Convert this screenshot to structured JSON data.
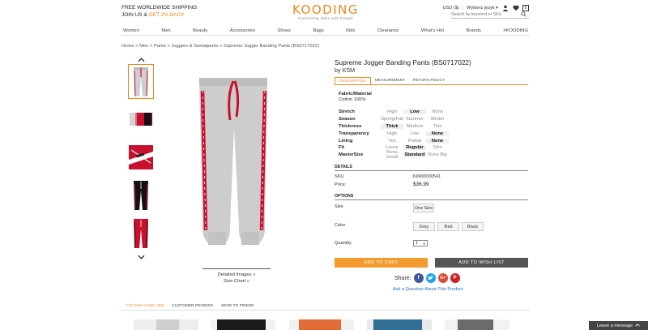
{
  "header": {
    "shipping_line1": "FREE WORLDWIDE SHIPPING",
    "join_prefix": "JOIN US & ",
    "join_accent": "GET 2% BACK",
    "logo_text": "KOODING",
    "logo_tagline": "Connecting Style with People",
    "currency": "USD ($)",
    "language": "Wybierz język",
    "cart_count": "0",
    "search_placeholder": "Search by keyword or SKU",
    "accent_color": "#e58a1f"
  },
  "nav": {
    "items": [
      "Women",
      "Men",
      "Beauty",
      "Accessories",
      "Shoes",
      "Bags",
      "Kids",
      "Clearance",
      "What's Hot",
      "Brands",
      "#KOODING"
    ]
  },
  "breadcrumb": "Home > Men > Pants > Joggers & Sweatpants > Supreme Jogger Banding Pants (BS0717022)",
  "gallery": {
    "detailed_images": "Detailed Images »",
    "size_chart": "Size Chart »"
  },
  "product": {
    "title": "Supreme Jogger Banding Pants (BS0717022)",
    "byline": "by KSM",
    "tabs": [
      "DESCRIPTION",
      "MEASUREMENT",
      "RETURN POLICY"
    ],
    "fabric_label": "Fabric/Material",
    "fabric_value": "Cotton 100%",
    "attributes": [
      {
        "name": "Stretch",
        "options": [
          "High",
          "Low",
          "None"
        ],
        "selected": 1
      },
      {
        "name": "Season",
        "options": [
          "Spring/Fall",
          "Summer",
          "Winter"
        ],
        "selected": -1
      },
      {
        "name": "Thickness",
        "options": [
          "Thick",
          "Medium",
          "Thin"
        ],
        "selected": 0
      },
      {
        "name": "Transparency",
        "options": [
          "High",
          "Low",
          "None"
        ],
        "selected": 2
      },
      {
        "name": "Lining",
        "options": [
          "Yes",
          "Partial",
          "None"
        ],
        "selected": 2
      },
      {
        "name": "Fit",
        "options": [
          "Loose",
          "Regular",
          "Slim"
        ],
        "selected": 1
      },
      {
        "name": "MasterSize",
        "options": [
          "Runs Small",
          "Standard",
          "Runs Big"
        ],
        "selected": 1
      }
    ],
    "details_label": "DETAILS",
    "sku_label": "SKU",
    "sku_value": "KIN00000541",
    "price_label": "Price:",
    "price_value": "$36.99",
    "options_label": "OPTIONS",
    "size_label": "Size",
    "size_option": "One Size",
    "color_label": "Color",
    "colors": [
      "Gray",
      "Red",
      "Black"
    ],
    "quantity_label": "Quantity",
    "quantity_value": "1",
    "add_to_cart": "ADD TO CART",
    "add_to_wishlist": "ADD TO WISH LIST",
    "share_label": "Share:",
    "ask_link": "Ask a Question About This Product"
  },
  "bottom_tabs": [
    "YOU MAY ALSO LIKE",
    "CUSTOMER REVIEWS",
    "SEND TO FRIEND"
  ],
  "chat": {
    "label": "Leave a message"
  }
}
